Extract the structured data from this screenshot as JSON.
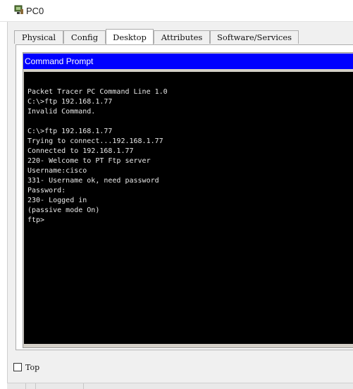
{
  "window": {
    "title": "PC0",
    "icon": "pc-device-icon"
  },
  "tabs": [
    {
      "label": "Physical",
      "active": false
    },
    {
      "label": "Config",
      "active": false
    },
    {
      "label": "Desktop",
      "active": true
    },
    {
      "label": "Attributes",
      "active": false
    },
    {
      "label": "Software/Services",
      "active": false
    }
  ],
  "command_prompt": {
    "title": "Command Prompt",
    "lines": [
      "Packet Tracer PC Command Line 1.0",
      "C:\\>ftp 192.168.1.77",
      "Invalid Command.",
      "",
      "C:\\>ftp 192.168.1.77",
      "Trying to connect...192.168.1.77",
      "Connected to 192.168.1.77",
      "220- Welcome to PT Ftp server",
      "Username:cisco",
      "331- Username ok, need password",
      "Password:",
      "230- Logged in",
      "(passive mode On)",
      "ftp>"
    ]
  },
  "footer": {
    "top_checkbox_label": "Top",
    "top_checked": false
  },
  "colors": {
    "prompt_title_bg": "#0000ff",
    "terminal_bg": "#000000",
    "terminal_text": "#e8e8e8"
  }
}
